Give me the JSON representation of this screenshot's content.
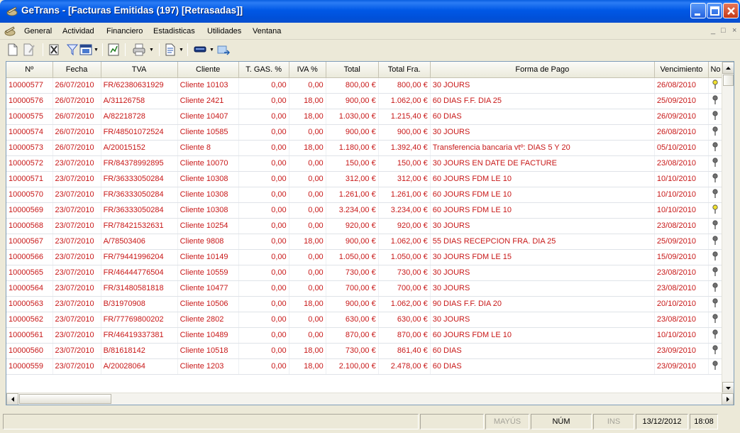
{
  "window": {
    "title": "GeTrans - [Facturas Emitidas (197) [Retrasadas]]"
  },
  "menu": {
    "items": [
      "General",
      "Actividad",
      "Financiero",
      "Estadisticas",
      "Utilidades",
      "Ventana"
    ]
  },
  "toolbar": {
    "icons": [
      "new-document-icon",
      "edit-document-icon",
      "delete-icon",
      "filter-icon",
      "view-options-icon",
      "report-icon",
      "print-icon",
      "export-icon",
      "send-icon",
      "send-forward-icon"
    ]
  },
  "grid": {
    "columns": [
      "Nº",
      "Fecha",
      "TVA",
      "Cliente",
      "T. GAS. %",
      "IVA %",
      "Total",
      "Total Fra.",
      "Forma de Pago",
      "Vencimiento",
      "No"
    ],
    "rows": [
      [
        "10000577",
        "26/07/2010",
        "FR/62380631929",
        "Cliente 10103",
        "0,00",
        "0,00",
        "800,00 €",
        "800,00 €",
        "30 JOURS",
        "26/08/2010",
        "yellow"
      ],
      [
        "10000576",
        "26/07/2010",
        "A/31126758",
        "Cliente 2421",
        "0,00",
        "18,00",
        "900,00 €",
        "1.062,00 €",
        "60 DIAS F.F. DIA 25",
        "25/09/2010",
        "gray"
      ],
      [
        "10000575",
        "26/07/2010",
        "A/82218728",
        "Cliente 10407",
        "0,00",
        "18,00",
        "1.030,00 €",
        "1.215,40 €",
        "60 DIAS",
        "26/09/2010",
        "gray"
      ],
      [
        "10000574",
        "26/07/2010",
        "FR/48501072524",
        "Cliente 10585",
        "0,00",
        "0,00",
        "900,00 €",
        "900,00 €",
        "30 JOURS",
        "26/08/2010",
        "gray"
      ],
      [
        "10000573",
        "26/07/2010",
        "A/20015152",
        "Cliente 8",
        "0,00",
        "18,00",
        "1.180,00 €",
        "1.392,40 €",
        "Transferencia bancaria vtº: DIAS 5 Y 20",
        "05/10/2010",
        "gray"
      ],
      [
        "10000572",
        "23/07/2010",
        "FR/84378992895",
        "Cliente 10070",
        "0,00",
        "0,00",
        "150,00 €",
        "150,00 €",
        "30 JOURS EN DATE DE FACTURE",
        "23/08/2010",
        "gray"
      ],
      [
        "10000571",
        "23/07/2010",
        "FR/36333050284",
        "Cliente 10308",
        "0,00",
        "0,00",
        "312,00 €",
        "312,00 €",
        "60 JOURS FDM LE 10",
        "10/10/2010",
        "gray"
      ],
      [
        "10000570",
        "23/07/2010",
        "FR/36333050284",
        "Cliente 10308",
        "0,00",
        "0,00",
        "1.261,00 €",
        "1.261,00 €",
        "60 JOURS FDM LE 10",
        "10/10/2010",
        "gray"
      ],
      [
        "10000569",
        "23/07/2010",
        "FR/36333050284",
        "Cliente 10308",
        "0,00",
        "0,00",
        "3.234,00 €",
        "3.234,00 €",
        "60 JOURS FDM LE 10",
        "10/10/2010",
        "yellow"
      ],
      [
        "10000568",
        "23/07/2010",
        "FR/78421532631",
        "Cliente 10254",
        "0,00",
        "0,00",
        "920,00 €",
        "920,00 €",
        "30 JOURS",
        "23/08/2010",
        "gray"
      ],
      [
        "10000567",
        "23/07/2010",
        "A/78503406",
        "Cliente 9808",
        "0,00",
        "18,00",
        "900,00 €",
        "1.062,00 €",
        "55 DIAS RECEPCION FRA. DIA 25",
        "25/09/2010",
        "gray"
      ],
      [
        "10000566",
        "23/07/2010",
        "FR/79441996204",
        "Cliente 10149",
        "0,00",
        "0,00",
        "1.050,00 €",
        "1.050,00 €",
        "30 JOURS FDM LE 15",
        "15/09/2010",
        "gray"
      ],
      [
        "10000565",
        "23/07/2010",
        "FR/46444776504",
        "Cliente 10559",
        "0,00",
        "0,00",
        "730,00 €",
        "730,00 €",
        "30 JOURS",
        "23/08/2010",
        "gray"
      ],
      [
        "10000564",
        "23/07/2010",
        "FR/31480581818",
        "Cliente 10477",
        "0,00",
        "0,00",
        "700,00 €",
        "700,00 €",
        "30 JOURS",
        "23/08/2010",
        "gray"
      ],
      [
        "10000563",
        "23/07/2010",
        "B/31970908",
        "Cliente 10506",
        "0,00",
        "18,00",
        "900,00 €",
        "1.062,00 €",
        "90 DIAS F.F. DIA 20",
        "20/10/2010",
        "gray"
      ],
      [
        "10000562",
        "23/07/2010",
        "FR/77769800202",
        "Cliente 2802",
        "0,00",
        "0,00",
        "630,00 €",
        "630,00 €",
        "30 JOURS",
        "23/08/2010",
        "gray"
      ],
      [
        "10000561",
        "23/07/2010",
        "FR/46419337381",
        "Cliente 10489",
        "0,00",
        "0,00",
        "870,00 €",
        "870,00 €",
        "60 JOURS FDM LE 10",
        "10/10/2010",
        "gray"
      ],
      [
        "10000560",
        "23/07/2010",
        "B/81618142",
        "Cliente 10518",
        "0,00",
        "18,00",
        "730,00 €",
        "861,40 €",
        "60 DIAS",
        "23/09/2010",
        "gray"
      ],
      [
        "10000559",
        "23/07/2010",
        "A/20028064",
        "Cliente 1203",
        "0,00",
        "18,00",
        "2.100,00 €",
        "2.478,00 €",
        "60 DIAS",
        "23/09/2010",
        "gray"
      ]
    ]
  },
  "status": {
    "mayus": "MAYÚS",
    "num": "NÚM",
    "ins": "INS",
    "date": "13/12/2012",
    "time": "18:08"
  },
  "colors": {
    "title_bar": "#0058e6",
    "row_text": "#c81818",
    "flag_yellow": "#f0e030",
    "flag_gray": "#707070"
  }
}
